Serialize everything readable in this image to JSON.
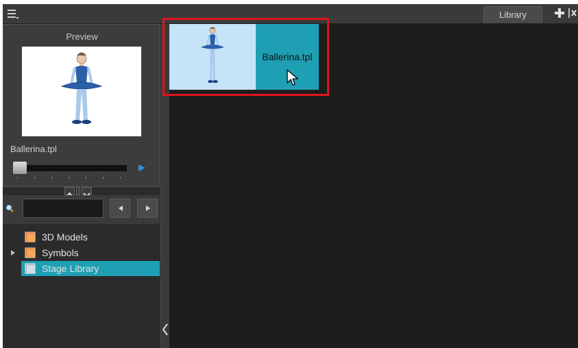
{
  "header": {
    "tab_label": "Library",
    "menu_icon": "hamburger-menu-icon",
    "add_icon": "plus-icon",
    "close_icon": "close-icon"
  },
  "preview": {
    "title": "Preview",
    "template_name": "Ballerina.tpl",
    "playback_position": 0
  },
  "search": {
    "value": "",
    "placeholder": ""
  },
  "tree": {
    "items": [
      {
        "label": "3D Models",
        "expandable": false,
        "selected": false
      },
      {
        "label": "Symbols",
        "expandable": true,
        "selected": false
      },
      {
        "label": "Stage Library",
        "expandable": false,
        "selected": true
      }
    ]
  },
  "main": {
    "tiles": [
      {
        "label": "Ballerina.tpl",
        "selected": true
      }
    ]
  },
  "colors": {
    "accent": "#1e9fb4",
    "highlight_frame": "#e0141a",
    "panel_bg": "#2b2b2b",
    "main_bg": "#1d1d1d"
  }
}
